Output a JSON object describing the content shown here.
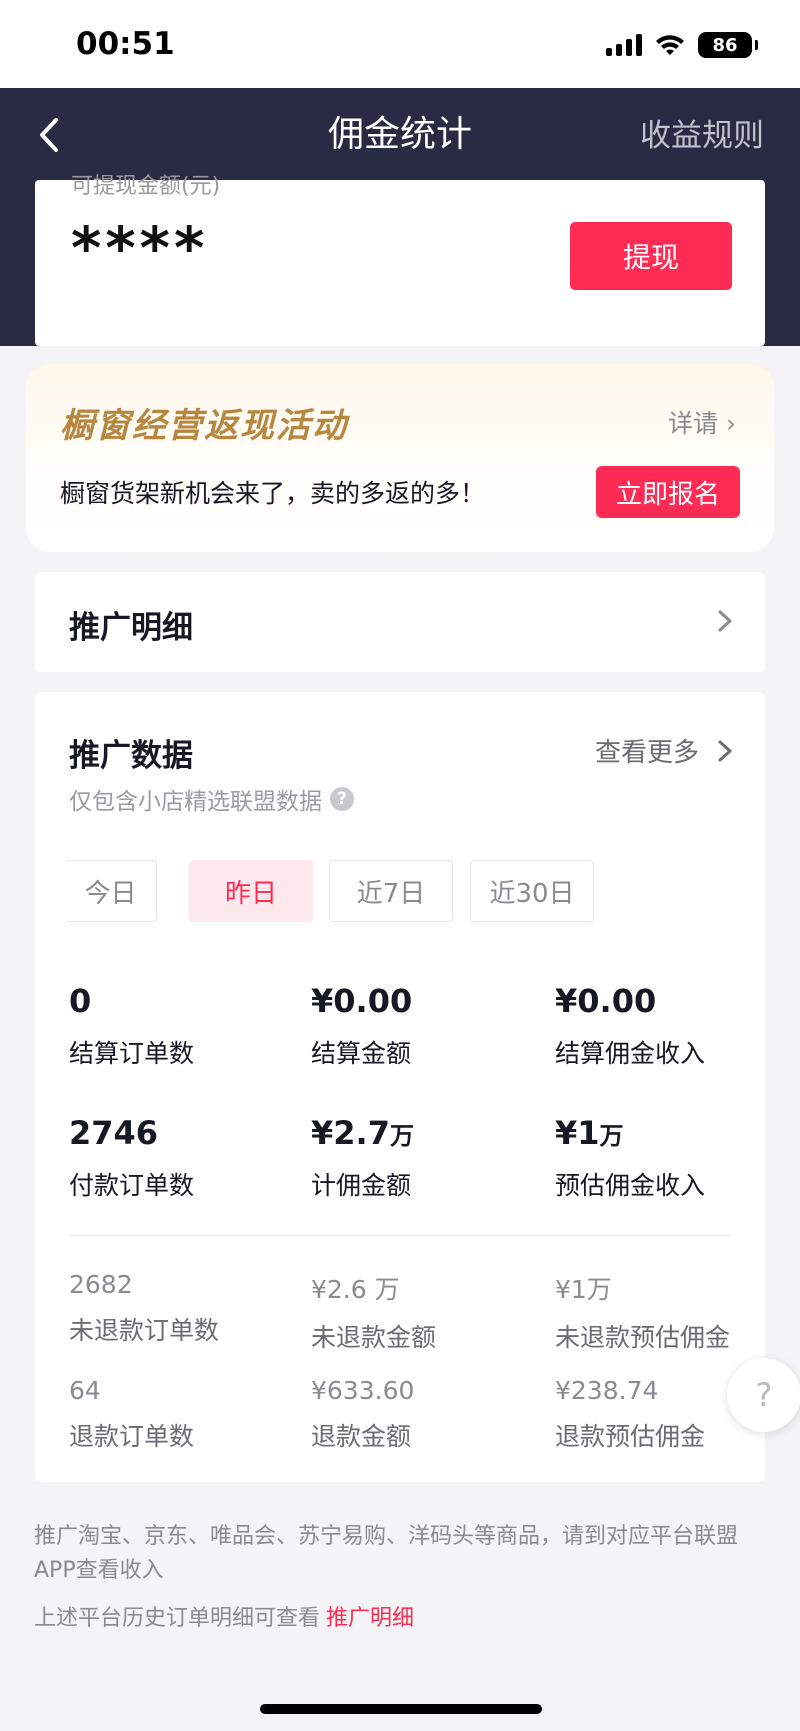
{
  "status_bar": {
    "time": "00:51",
    "battery": "86"
  },
  "nav": {
    "title": "佣金统计",
    "rule_link": "收益规则"
  },
  "balance": {
    "label": "可提现金额(元)",
    "amount": "****",
    "withdraw_label": "提现"
  },
  "promo": {
    "title": "橱窗经营返现活动",
    "detail": "详请 ›",
    "subtitle": "橱窗货架新机会来了，卖的多返的多！",
    "cta": "立即报名"
  },
  "promo_detail_row": {
    "label": "推广明细"
  },
  "promo_data": {
    "title": "推广数据",
    "more": "查看更多",
    "note": "仅包含小店精选联盟数据",
    "tabs": [
      {
        "label": "今日",
        "active": false
      },
      {
        "label": "昨日",
        "active": true
      },
      {
        "label": "近7日",
        "active": false
      },
      {
        "label": "近30日",
        "active": false
      }
    ],
    "metrics_primary": [
      {
        "value": "0",
        "unit": "",
        "label": "结算订单数"
      },
      {
        "value": "¥0.00",
        "unit": "",
        "label": "结算金额"
      },
      {
        "value": "¥0.00",
        "unit": "",
        "label": "结算佣金收入"
      },
      {
        "value": "2746",
        "unit": "",
        "label": "付款订单数"
      },
      {
        "value": "¥2.7",
        "unit": "万",
        "label": "计佣金额"
      },
      {
        "value": "¥1",
        "unit": "万",
        "label": "预估佣金收入"
      }
    ],
    "metrics_secondary": [
      {
        "value": "2682",
        "label": "未退款订单数"
      },
      {
        "value": "¥2.6 万",
        "label": "未退款金额"
      },
      {
        "value": "¥1万",
        "label": "未退款预估佣金"
      },
      {
        "value": "64",
        "label": "退款订单数"
      },
      {
        "value": "¥633.60",
        "label": "退款金额"
      },
      {
        "value": "¥238.74",
        "label": "退款预估佣金"
      }
    ]
  },
  "footer": {
    "note1": "推广淘宝、京东、唯品会、苏宁易购、洋码头等商品，请到对应平台联盟APP查看收入",
    "note2": "上述平台历史订单明细可查看",
    "link": "推广明细"
  },
  "float_help": "?"
}
